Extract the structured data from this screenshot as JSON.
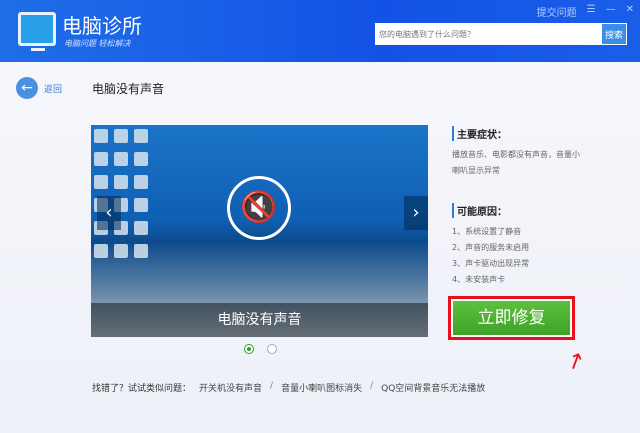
{
  "header": {
    "app_title": "电脑诊所",
    "subtitle": "电脑问题 轻松解决",
    "submit_label": "提交问题",
    "search_placeholder": "您的电脑遇到了什么问题？",
    "search_button": "搜索"
  },
  "nav": {
    "back_label": "返回",
    "page_title": "电脑没有声音"
  },
  "carousel": {
    "caption": "电脑没有声音",
    "slide_count": 2,
    "active_slide": 1
  },
  "symptoms": {
    "heading": "主要症状：",
    "text": "播放音乐、电影都没有声音，音量小喇叭显示异常"
  },
  "causes": {
    "heading": "可能原因：",
    "items": [
      "1、系统设置了静音",
      "2、声音的服务未启用",
      "3、声卡驱动出现异常",
      "4、未安装声卡"
    ]
  },
  "fix_button": "立即修复",
  "similar": {
    "label": "找错了？试试类似问题：",
    "links": [
      "开关机没有声音",
      "音量小喇叭图标消失",
      "QQ空间背景音乐无法播放"
    ],
    "sep": "/"
  },
  "colors": {
    "header": "#1352e6",
    "fix": "#3ea12a",
    "highlight": "#e8101a"
  }
}
